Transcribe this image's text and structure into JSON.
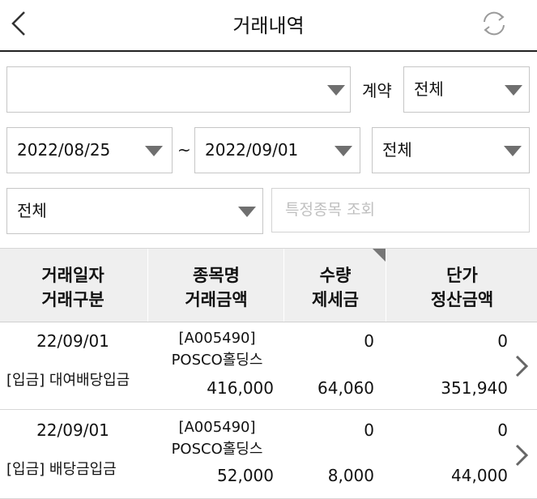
{
  "header": {
    "title": "거래내역"
  },
  "filters": {
    "account_value": "",
    "contract_label": "계약",
    "contract_value": "전체",
    "date_from": "2022/08/25",
    "date_sep": "~",
    "date_to": "2022/09/01",
    "type_value": "전체",
    "category_value": "전체",
    "search_placeholder": "특정종목 조회"
  },
  "table": {
    "headers": [
      [
        "거래일자",
        "거래구분"
      ],
      [
        "종목명",
        "거래금액"
      ],
      [
        "수량",
        "제세금"
      ],
      [
        "단가",
        "정산금액"
      ]
    ],
    "rows": [
      {
        "date": "22/09/01",
        "type": "[입금] 대여배당입금",
        "code": "[A005490]",
        "name": "POSCO홀딩스",
        "amount": "416,000",
        "qty": "0",
        "tax": "64,060",
        "price": "0",
        "settle": "351,940"
      },
      {
        "date": "22/09/01",
        "type": "[입금] 배당금입금",
        "code": "[A005490]",
        "name": "POSCO홀딩스",
        "amount": "52,000",
        "qty": "0",
        "tax": "8,000",
        "price": "0",
        "settle": "44,000"
      }
    ]
  },
  "icons": [
    "back-arrow-icon",
    "refresh-icon",
    "dropdown-arrow-icon",
    "chevron-right-icon"
  ],
  "colors": {
    "header_bg": "#efefef",
    "border": "#c6c6c6",
    "text": "#111111"
  }
}
